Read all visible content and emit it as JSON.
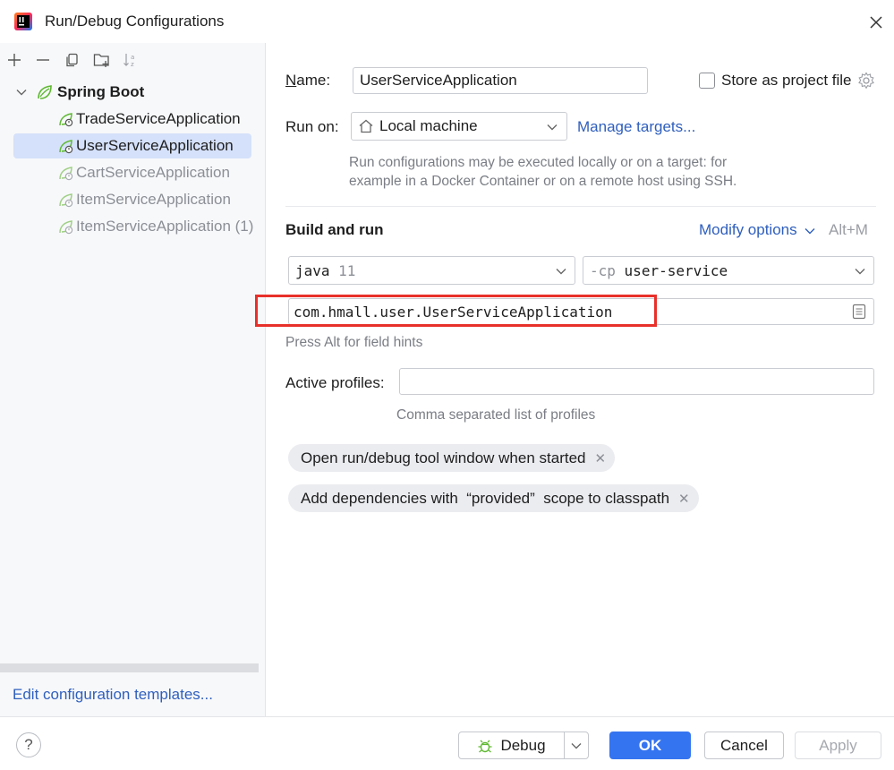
{
  "window": {
    "title": "Run/Debug Configurations"
  },
  "toolbar": {
    "icons": [
      "add-icon",
      "remove-icon",
      "copy-icon",
      "new-folder-icon",
      "sort-icon"
    ]
  },
  "tree": {
    "group_label": "Spring Boot",
    "items": [
      {
        "label": "TradeServiceApplication",
        "selected": false,
        "dimmed": false
      },
      {
        "label": "UserServiceApplication",
        "selected": true,
        "dimmed": false
      },
      {
        "label": "CartServiceApplication",
        "selected": false,
        "dimmed": true
      },
      {
        "label": "ItemServiceApplication",
        "selected": false,
        "dimmed": true
      },
      {
        "label": "ItemServiceApplication (1)",
        "selected": false,
        "dimmed": true
      }
    ]
  },
  "left_footer": {
    "edit_templates": "Edit configuration templates..."
  },
  "form": {
    "name_label_first": "N",
    "name_label_rest": "ame:",
    "name_value": "UserServiceApplication",
    "store_label": "Store as project file",
    "run_on_label": "Run on:",
    "run_on_value": "Local machine",
    "manage_targets": "Manage targets...",
    "run_on_hint_1": "Run configurations may be executed locally or on a target: for",
    "run_on_hint_2": "example in a Docker Container or on a remote host using SSH.",
    "build_run_title": "Build and run",
    "modify_options": "Modify options",
    "modify_shortcut": "Alt+M",
    "jdk_name": "java",
    "jdk_version": "11",
    "cp_flag": "-cp",
    "cp_module": "user-service",
    "main_class": "com.hmall.user.UserServiceApplication",
    "field_hint": "Press Alt for field hints",
    "active_profiles_label": "Active profiles:",
    "active_profiles_value": "",
    "profiles_hint": "Comma separated list of profiles",
    "chip_1": "Open run/debug tool window when started",
    "chip_2": "Add dependencies with  “provided”  scope to classpath",
    "highlight_color": "#e8302a"
  },
  "buttons": {
    "debug": "Debug",
    "ok": "OK",
    "cancel": "Cancel",
    "apply": "Apply",
    "help": "?"
  },
  "colors": {
    "accent": "#3574f0",
    "link": "#2f5fbd",
    "selection": "#d5e1fa",
    "spring_green": "#5fb832"
  }
}
